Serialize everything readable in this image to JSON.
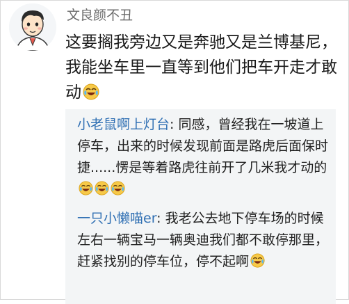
{
  "comment": {
    "author": "文良颜不丑",
    "text": "这要搁我旁边又是奔驰又是兰博基尼，我能坐车里一直等到他们把车开走才敢动",
    "trailing_emoji": "laugh-cry-icon"
  },
  "replies": [
    {
      "author": "小老鼠啊上灯台",
      "separator": ": ",
      "text": "同感，曾经我在一坡道上停车，出来的时候发现前面是路虎后面保时捷......愣是等着路虎往前开了几米我才动的",
      "emojis": [
        "laugh-cry-icon",
        "laugh-cry-icon",
        "laugh-cry-icon"
      ]
    },
    {
      "author": "一只小懒喵er",
      "separator": ": ",
      "text": "我老公去地下停车场的时候左右一辆宝马一辆奥迪我们都不敢停那里，赶紧找别的停车位，停不起啊",
      "emojis": [
        "laugh-cry-icon"
      ]
    }
  ],
  "colors": {
    "reply_name": "#2f6fb3",
    "username": "#6b6b6b",
    "reply_bg": "#f3f5f6"
  }
}
